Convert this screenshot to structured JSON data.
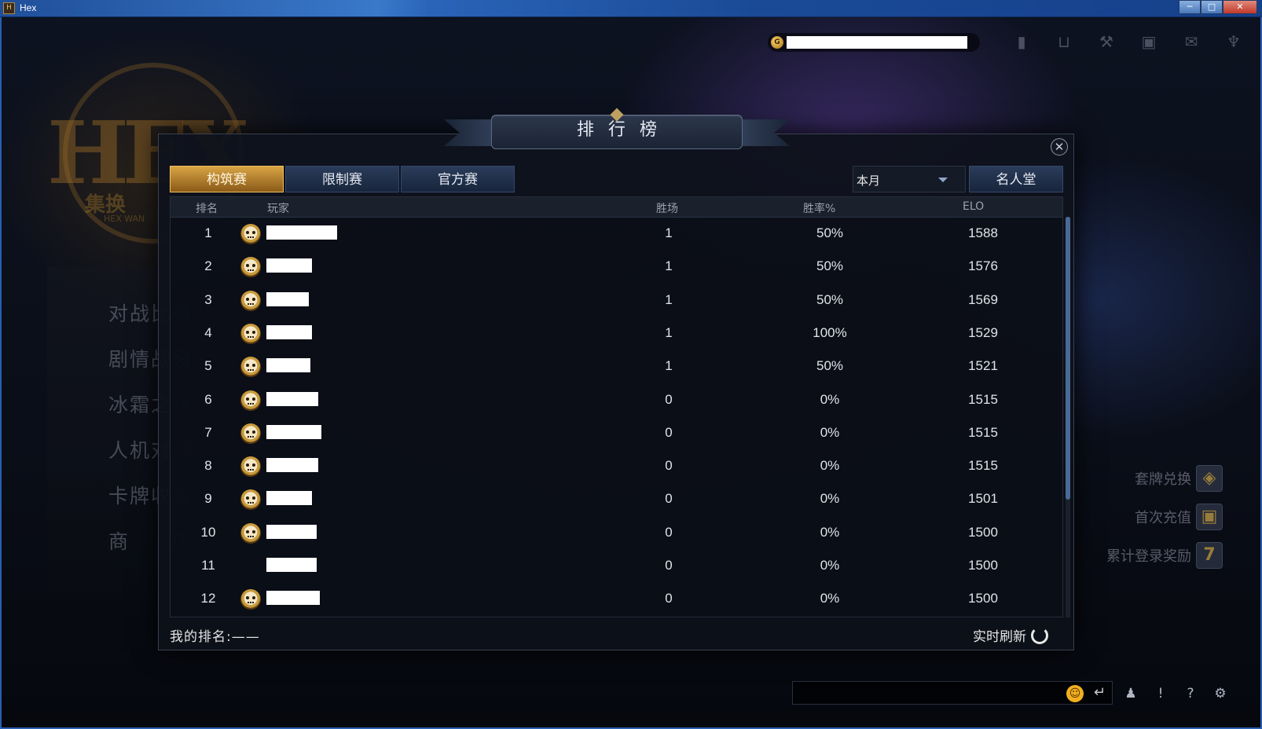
{
  "window": {
    "title": "Hex"
  },
  "topbar": {
    "coin_label": "G",
    "icons": [
      "chart-icon",
      "cart-icon",
      "hammer-icon",
      "box-icon",
      "mail-icon",
      "trophy-icon"
    ]
  },
  "background": {
    "logo_text": "HEX",
    "logo_sub": "集换",
    "logo_sub2": "HEX WAN",
    "left_menu": [
      "对战比赛",
      "剧情战役",
      "冰霜之环",
      "人机对战",
      "卡牌收藏",
      "商　　店"
    ],
    "promos": [
      {
        "label": "套牌兑换",
        "icon": "◈"
      },
      {
        "label": "首次充值",
        "icon": "▣"
      },
      {
        "label": "累计登录奖励",
        "icon": "7"
      }
    ]
  },
  "dialog": {
    "title": "排行榜",
    "tabs": [
      "构筑赛",
      "限制赛",
      "官方赛"
    ],
    "active_tab": 0,
    "period": "本月",
    "hall_of_fame": "名人堂",
    "columns": {
      "rank": "排名",
      "player": "玩家",
      "wins": "胜场",
      "win_rate": "胜率%",
      "elo": "ELO"
    },
    "rows": [
      {
        "rank": "1",
        "wins": "1",
        "win_rate": "50%",
        "elo": "1588",
        "skull": true
      },
      {
        "rank": "2",
        "wins": "1",
        "win_rate": "50%",
        "elo": "1576",
        "skull": true
      },
      {
        "rank": "3",
        "wins": "1",
        "win_rate": "50%",
        "elo": "1569",
        "skull": true
      },
      {
        "rank": "4",
        "wins": "1",
        "win_rate": "100%",
        "elo": "1529",
        "skull": true
      },
      {
        "rank": "5",
        "wins": "1",
        "win_rate": "50%",
        "elo": "1521",
        "skull": true
      },
      {
        "rank": "6",
        "wins": "0",
        "win_rate": "0%",
        "elo": "1515",
        "skull": true
      },
      {
        "rank": "7",
        "wins": "0",
        "win_rate": "0%",
        "elo": "1515",
        "skull": true
      },
      {
        "rank": "8",
        "wins": "0",
        "win_rate": "0%",
        "elo": "1515",
        "skull": true
      },
      {
        "rank": "9",
        "wins": "0",
        "win_rate": "0%",
        "elo": "1501",
        "skull": true
      },
      {
        "rank": "10",
        "wins": "0",
        "win_rate": "0%",
        "elo": "1500",
        "skull": true
      },
      {
        "rank": "11",
        "wins": "0",
        "win_rate": "0%",
        "elo": "1500",
        "skull": false
      },
      {
        "rank": "12",
        "wins": "0",
        "win_rate": "0%",
        "elo": "1500",
        "skull": true
      }
    ],
    "my_rank": "我的排名:——",
    "refresh_label": "实时刷新"
  },
  "chat": {
    "bottom_icons": [
      "friends-icon",
      "alert-icon",
      "help-icon",
      "settings-icon"
    ]
  }
}
